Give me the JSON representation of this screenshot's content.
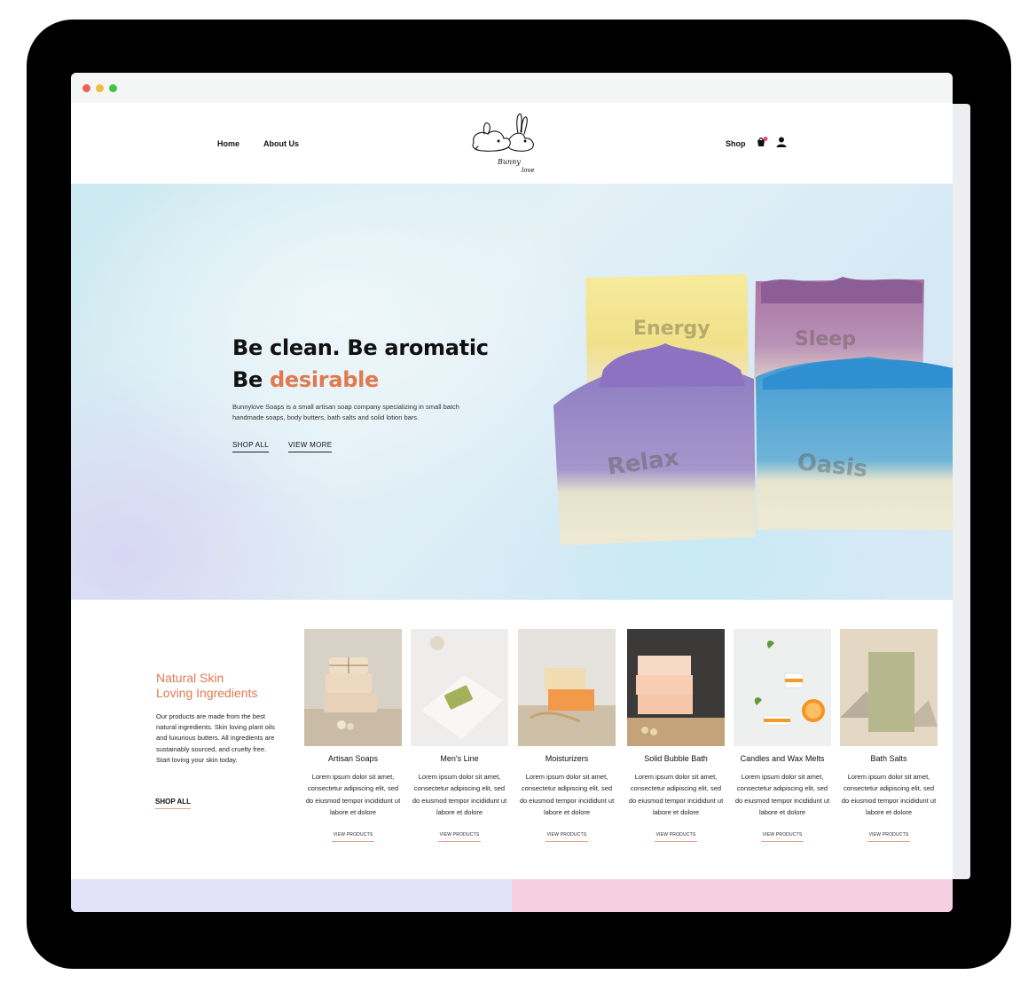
{
  "colors": {
    "accent": "#e07a4f",
    "underline": "#e8a18a",
    "strip_left": "#e2e3fb",
    "strip_right": "#f6cfe0"
  },
  "nav": {
    "home": "Home",
    "about": "About Us",
    "shop": "Shop",
    "cart_icon": "cart-icon",
    "account_icon": "user-icon"
  },
  "logo": {
    "script_text": "Bunnylove"
  },
  "hero": {
    "line1": "Be clean. Be aromatic",
    "line2_prefix": "Be ",
    "line2_accent": "desirable",
    "description": "Bunnylove Soaps is a small artisan soap company specializing in small batch handmade soaps, body butters, bath salts and solid lotion bars.",
    "shop_all": "SHOP ALL",
    "view_more": "VIEW MORE",
    "soap_labels": [
      "Energy",
      "Sleep",
      "Relax",
      "Oasis"
    ]
  },
  "intro": {
    "title_line1": "Natural Skin",
    "title_line2": "Loving Ingredients",
    "description": "Our products are made from the best natural ingredients.  Skin loving plant oils and luxurious butters. All ingredients are sustainably sourced, and cruelty free.  Start loving your skin today.",
    "shop_all": "SHOP ALL"
  },
  "categories": [
    {
      "name": "Artisan Soaps",
      "desc": "Lorem ipsum dolor sit amet, consectetur adipiscing elit, sed do eiusmod tempor incididunt ut labore et dolore",
      "button": "VIEW PRODUCTS"
    },
    {
      "name": "Men's Line",
      "desc": "Lorem ipsum dolor sit amet, consectetur adipiscing elit, sed do eiusmod tempor incididunt ut labore et dolore",
      "button": "VIEW PRODUCTS"
    },
    {
      "name": "Moisturizers",
      "desc": "Lorem ipsum dolor sit amet, consectetur adipiscing elit, sed do eiusmod tempor incididunt ut labore et dolore",
      "button": "VIEW PRODUCTS"
    },
    {
      "name": "Solid Bubble Bath",
      "desc": "Lorem ipsum dolor sit amet, consectetur adipiscing elit, sed do eiusmod tempor incididunt ut labore et dolore",
      "button": "VIEW PRODUCTS"
    },
    {
      "name": "Candles and Wax Melts",
      "desc": "Lorem ipsum dolor sit amet, consectetur adipiscing elit, sed do eiusmod tempor incididunt ut labore et dolore",
      "button": "VIEW PRODUCTS"
    },
    {
      "name": "Bath Salts",
      "desc": "Lorem ipsum dolor sit amet, consectetur adipiscing elit, sed do eiusmod tempor incididunt ut labore et dolore",
      "button": "VIEW PRODUCTS"
    }
  ]
}
